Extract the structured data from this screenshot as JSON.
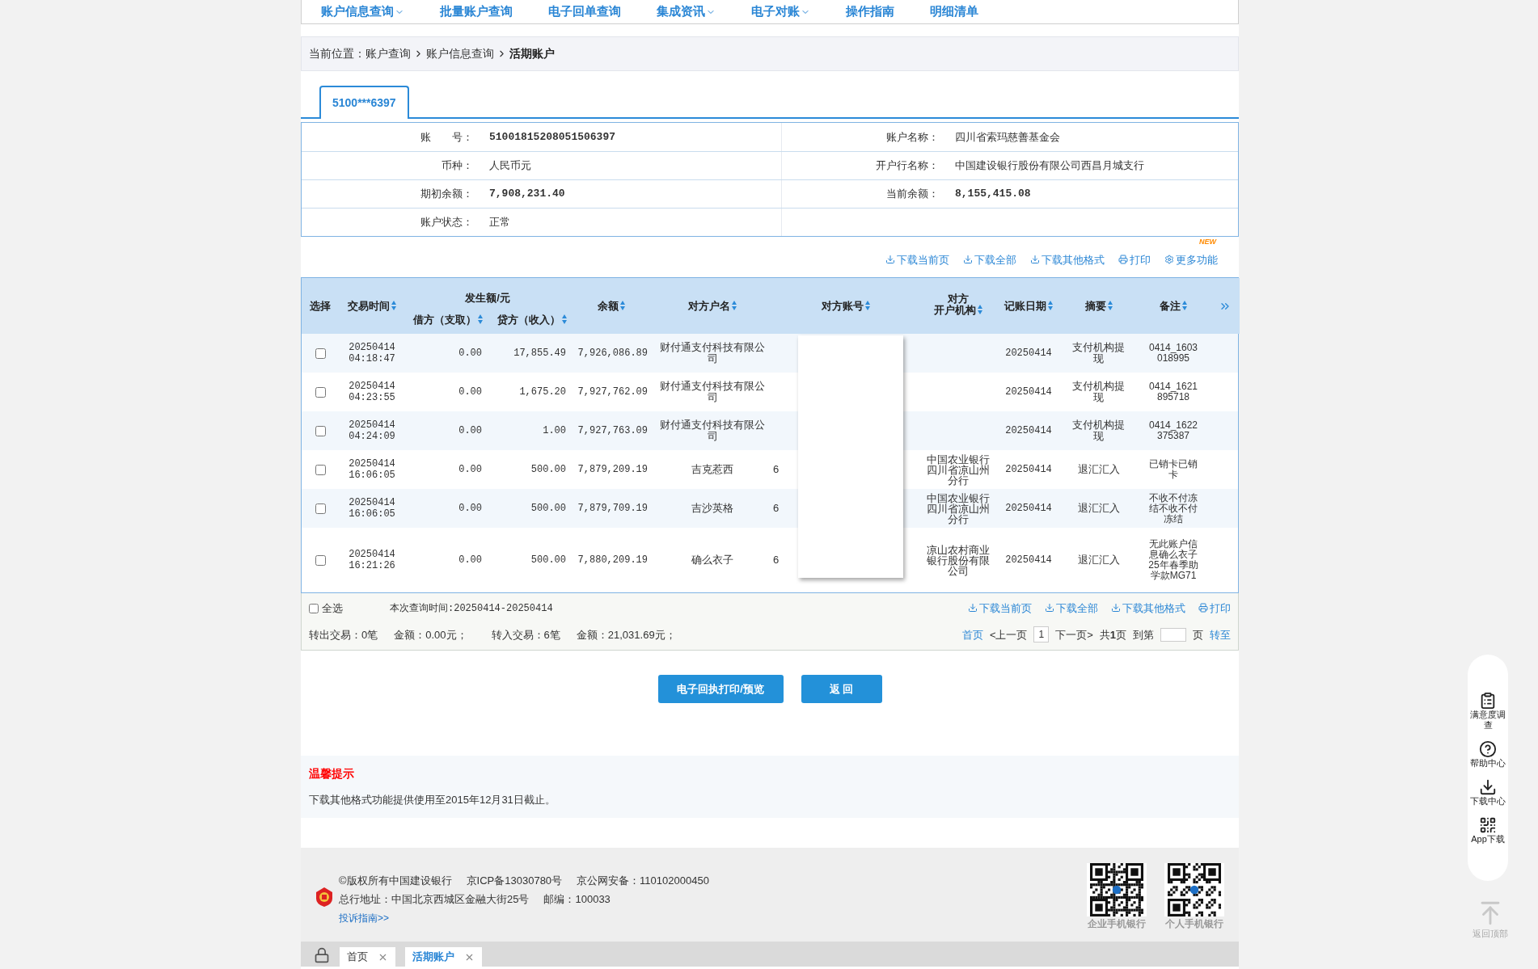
{
  "nav": [
    {
      "label": "账户信息查询",
      "dropdown": true
    },
    {
      "label": "批量账户查询",
      "dropdown": false
    },
    {
      "label": "电子回单查询",
      "dropdown": false
    },
    {
      "label": "集成资讯",
      "dropdown": true
    },
    {
      "label": "电子对账",
      "dropdown": true
    },
    {
      "label": "操作指南",
      "dropdown": false
    },
    {
      "label": "明细清单",
      "dropdown": false
    }
  ],
  "breadcrumb": {
    "prefix": "当前位置：",
    "items": [
      "账户查询",
      "账户信息查询",
      "活期账户"
    ]
  },
  "account_tabs": [
    {
      "label": "5100***6397",
      "selected": true
    }
  ],
  "account_info": [
    {
      "left": {
        "label": "账　　号：",
        "value": "51001815208051506397",
        "kind": "number"
      },
      "right": {
        "label": "账户名称：",
        "value": "四川省索玛慈善基金会",
        "kind": "text"
      }
    },
    {
      "left": {
        "label": "币种：",
        "value": "人民币元",
        "kind": "text"
      },
      "right": {
        "label": "开户行名称：",
        "value": "中国建设银行股份有限公司西昌月城支行",
        "kind": "text"
      }
    },
    {
      "left": {
        "label": "期初余额：",
        "value": "7,908,231.40",
        "kind": "number"
      },
      "right": {
        "label": "当前余额：",
        "value": "8,155,415.08",
        "kind": "number"
      }
    },
    {
      "left": {
        "label": "账户状态：",
        "value": "正常",
        "kind": "text"
      }
    }
  ],
  "toolbar": [
    {
      "label": "下载当前页",
      "new": false
    },
    {
      "label": "下载全部",
      "new": false
    },
    {
      "label": "下载其他格式",
      "new": false
    },
    {
      "label": "打印",
      "new": false
    },
    {
      "label": "更多功能",
      "new": true
    }
  ],
  "new_badge": "NEW",
  "table": {
    "group_label": "发生额/元",
    "columns": [
      {
        "label": "选择",
        "sortable": false
      },
      {
        "label": "交易时间",
        "sortable": true
      },
      {
        "label": "借方（支取）",
        "sortable": true
      },
      {
        "label": "贷方（收入）",
        "sortable": true
      },
      {
        "label": "余额",
        "sortable": true
      },
      {
        "label": "对方户名",
        "sortable": true
      },
      {
        "label": "对方账号",
        "sortable": true
      },
      {
        "lines": [
          "对方",
          "开户机构"
        ],
        "sortable": true
      },
      {
        "label": "记账日期",
        "sortable": true
      },
      {
        "label": "摘要",
        "sortable": true
      },
      {
        "label": "备注",
        "sortable": true
      }
    ],
    "rows": [
      {
        "checked": false,
        "date": "20250414",
        "time": "04:18:47",
        "debit": "0.00",
        "credit": "17,855.49",
        "balance": "7,926,086.89",
        "name": "财付通支付科技有限公司",
        "account": "",
        "bank": "",
        "post_date": "20250414",
        "summary": "支付机构提现",
        "remark": "0414_1603018995"
      },
      {
        "checked": false,
        "date": "20250414",
        "time": "04:23:55",
        "debit": "0.00",
        "credit": "1,675.20",
        "balance": "7,927,762.09",
        "name": "财付通支付科技有限公司",
        "account": "",
        "bank": "",
        "post_date": "20250414",
        "summary": "支付机构提现",
        "remark": "0414_1621895718"
      },
      {
        "checked": false,
        "date": "20250414",
        "time": "04:24:09",
        "debit": "0.00",
        "credit": "1.00",
        "balance": "7,927,763.09",
        "name": "财付通支付科技有限公司",
        "account": "",
        "bank": "",
        "post_date": "20250414",
        "summary": "支付机构提现",
        "remark": "0414_1622375387"
      },
      {
        "checked": false,
        "date": "20250414",
        "time": "16:06:05",
        "debit": "0.00",
        "credit": "500.00",
        "balance": "7,879,209.19",
        "name": "吉克惹西",
        "account": "6",
        "bank": "中国农业银行四川省凉山州分行",
        "post_date": "20250414",
        "summary": "退汇汇入",
        "remark": "已销卡已销卡"
      },
      {
        "checked": false,
        "date": "20250414",
        "time": "16:06:05",
        "debit": "0.00",
        "credit": "500.00",
        "balance": "7,879,709.19",
        "name": "吉沙英格",
        "account": "6",
        "bank": "中国农业银行四川省凉山州分行",
        "post_date": "20250414",
        "summary": "退汇汇入",
        "remark": "不收不付冻结不收不付冻结"
      },
      {
        "checked": false,
        "date": "20250414",
        "time": "16:21:26",
        "debit": "0.00",
        "credit": "500.00",
        "balance": "7,880,209.19",
        "name": "确么衣子",
        "account": "6",
        "bank": "凉山农村商业银行股份有限公司",
        "post_date": "20250414",
        "summary": "退汇汇入",
        "remark": "无此账户信息确么衣子25年春季助学款MG71"
      }
    ]
  },
  "summary": {
    "select_all": {
      "label": "全选",
      "checked": false
    },
    "query_time": "本次查询时间:20250414-20250414",
    "links": [
      "下载当前页",
      "下载全部",
      "下载其他格式",
      "打印"
    ],
    "stats": [
      "转出交易：0笔",
      "金额：0.00元；",
      "转入交易：6笔",
      "金额：21,031.69元；"
    ],
    "pagination": {
      "first": "首页",
      "prev": "<上一页",
      "page": "1",
      "next": "下一页>",
      "total": "共**1**页",
      "goto": "到第",
      "goto_suffix": "页",
      "go": "转至"
    }
  },
  "buttons": [
    "电子回执打印/预览",
    "返 回"
  ],
  "tips": {
    "title": "温馨提示",
    "text": "下载其他格式功能提供使用至2015年12月31日截止。"
  },
  "footer": {
    "line1": [
      "©版权所有中国建设银行",
      "京ICP备13030780号",
      "京公网安备：110102000450"
    ],
    "line2": [
      "总行地址：中国北京西城区金融大街25号",
      "邮编：100033"
    ],
    "link": "投诉指南>>",
    "qr_labels": [
      "企业手机银行",
      "个人手机银行"
    ]
  },
  "bottom_tabs": [
    {
      "label": "首页",
      "selected": false
    },
    {
      "label": "活期账户",
      "selected": true
    }
  ],
  "side_tools": [
    "满意度调查",
    "帮助中心",
    "下载中心",
    "App下载"
  ],
  "back_top": "返回顶部"
}
